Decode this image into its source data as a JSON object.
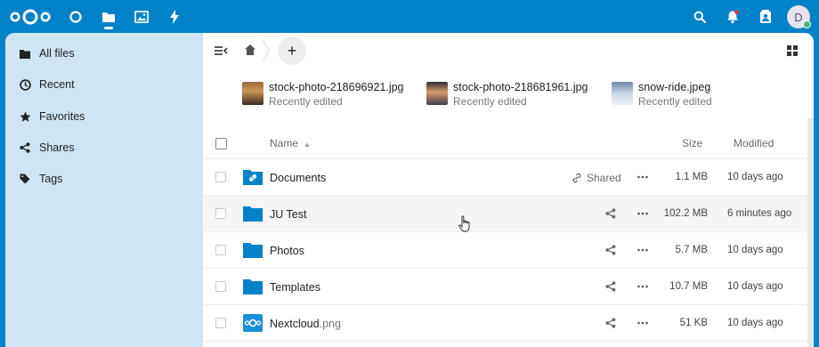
{
  "header": {
    "apps": [
      "dashboard-icon",
      "files-icon",
      "photos-icon",
      "activity-icon"
    ],
    "active_app": "files",
    "right_icons": [
      "search-icon",
      "notifications-icon",
      "contacts-icon"
    ],
    "avatar_initial": "D",
    "avatar_status_color": "#49b382"
  },
  "colors": {
    "primary": "#0082c9",
    "sidebar_bg": "#cfe5f3",
    "folder": "#0082c9"
  },
  "sidebar": {
    "items": [
      {
        "label": "All files",
        "icon": "folder-icon"
      },
      {
        "label": "Recent",
        "icon": "clock-icon"
      },
      {
        "label": "Favorites",
        "icon": "star-icon"
      },
      {
        "label": "Shares",
        "icon": "share-icon"
      },
      {
        "label": "Tags",
        "icon": "tag-icon"
      }
    ]
  },
  "toolbar": {
    "new_label": "+"
  },
  "recent": [
    {
      "name": "stock-photo-218696921.jpg",
      "sub": "Recently edited"
    },
    {
      "name": "stock-photo-218681961.jpg",
      "sub": "Recently edited"
    },
    {
      "name": "snow-ride.jpeg",
      "sub": "Recently edited"
    }
  ],
  "table": {
    "headers": {
      "name": "Name",
      "size": "Size",
      "modified": "Modified"
    },
    "sort_indicator": "▲",
    "rows": [
      {
        "name": "Documents",
        "ext": "",
        "type": "shared-folder",
        "share_label": "Shared",
        "size": "1.1 MB",
        "modified": "10 days ago"
      },
      {
        "name": "JU Test",
        "ext": "",
        "type": "folder",
        "share_label": "",
        "size": "102.2 MB",
        "modified": "6 minutes ago"
      },
      {
        "name": "Photos",
        "ext": "",
        "type": "folder",
        "share_label": "",
        "size": "5.7 MB",
        "modified": "10 days ago"
      },
      {
        "name": "Templates",
        "ext": "",
        "type": "folder",
        "share_label": "",
        "size": "10.7 MB",
        "modified": "10 days ago"
      },
      {
        "name": "Nextcloud",
        "ext": ".png",
        "type": "image",
        "share_label": "",
        "size": "51 KB",
        "modified": "10 days ago"
      }
    ]
  }
}
